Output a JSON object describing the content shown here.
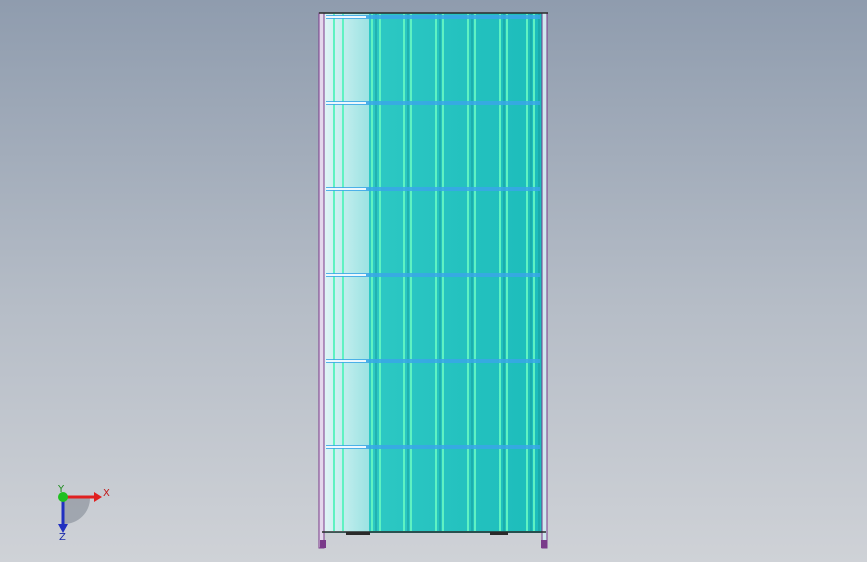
{
  "viewport": {
    "background_top": "#8f9cae",
    "background_bottom": "#cfd2d7"
  },
  "model": {
    "panel_color": "#1fbfbf",
    "rib_color": "#5ff2c2",
    "highlight_color": "#d7f3f5",
    "edge_color": "#7a3a8a",
    "frame_color": "#2a2a2a",
    "vertical_ribs": 10,
    "horizontal_bands": 6
  },
  "triad": {
    "x_label": "X",
    "y_label": "Y",
    "z_label": "Z",
    "x_color": "#e02020",
    "y_color": "#20c020",
    "z_color": "#2030c0",
    "icons": [
      "x-axis-arrow-icon",
      "y-axis-icon",
      "z-axis-arrow-icon",
      "origin-sphere-icon"
    ]
  }
}
